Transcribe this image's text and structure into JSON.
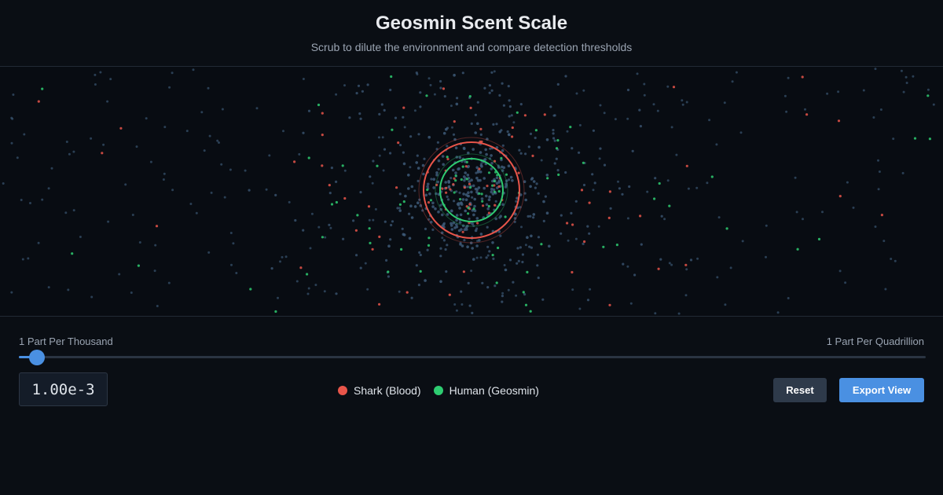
{
  "header": {
    "title": "Geosmin Scent Scale",
    "subtitle": "Scrub to dilute the environment and compare detection thresholds"
  },
  "scale": {
    "left_label": "1 Part Per Thousand",
    "right_label": "1 Part Per Quadrillion",
    "slider_fraction": 0.01,
    "readout": "1.00e-3"
  },
  "legend": {
    "items": [
      {
        "label": "Shark (Blood)",
        "color": "#e8554a"
      },
      {
        "label": "Human (Geosmin)",
        "color": "#2ecc71"
      }
    ]
  },
  "buttons": {
    "reset_label": "Reset",
    "export_label": "Export View"
  },
  "colors": {
    "background_particle": "#3d5a78",
    "shark": "#e8554a",
    "human": "#2ecc71",
    "accent": "#4a90e2"
  }
}
